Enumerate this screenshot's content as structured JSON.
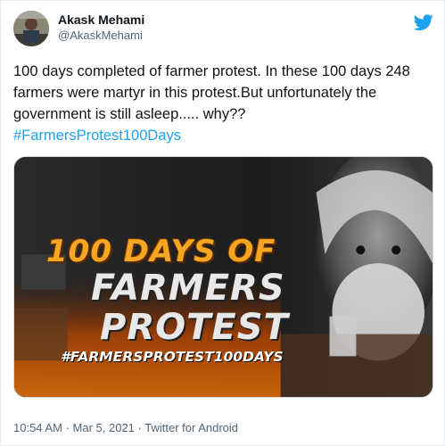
{
  "author": {
    "display_name": "Akask Mehami",
    "handle": "@AkaskMehami"
  },
  "tweet": {
    "text": "100 days completed of farmer protest. In these 100 days 248 farmers were martyr in this protest.But unfortunately the government is still asleep..... why??",
    "hashtag": "#FarmersProtest100Days"
  },
  "media": {
    "line1": "100 DAYS OF",
    "line2": "FARMERS",
    "line3": "PROTEST",
    "line4": "#FARMERSPROTEST100DAYS"
  },
  "meta": {
    "time": "10:54 AM",
    "separator": "·",
    "date": "Mar 5, 2021",
    "source": "Twitter for Android"
  },
  "icons": {
    "logo": "twitter-bird-icon",
    "avatar": "user-avatar"
  },
  "colors": {
    "accent": "#1da1f2",
    "text": "#0f1419",
    "secondary": "#536471"
  }
}
